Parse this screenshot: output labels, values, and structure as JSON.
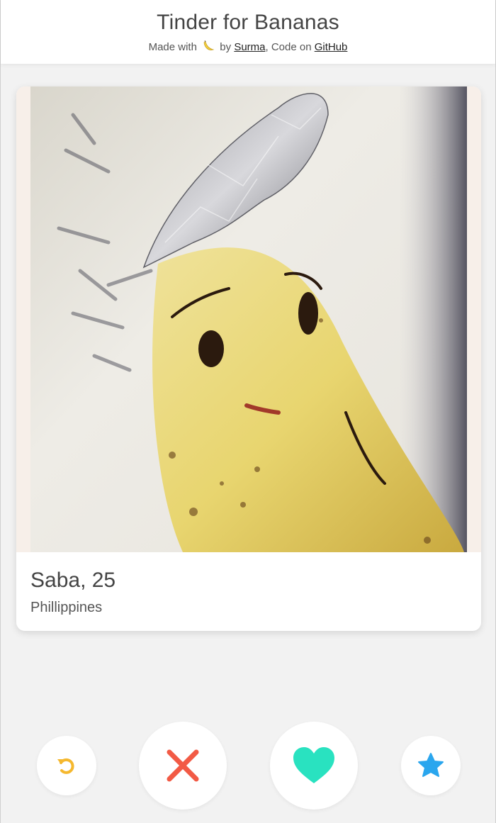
{
  "header": {
    "title": "Tinder for Bananas",
    "made_with": "Made with",
    "by": "by",
    "author": "Surma",
    "code_on": ", Code on",
    "repo": "GitHub"
  },
  "profile": {
    "name": "Saba",
    "age_separator": ", 25",
    "location": "Phillippines"
  },
  "actions": [
    {
      "id": "rewind",
      "icon": "rewind-icon",
      "color": "#f5b82e"
    },
    {
      "id": "nope",
      "icon": "close-icon",
      "color": "#f25a45"
    },
    {
      "id": "like",
      "icon": "heart-icon",
      "color": "#29e2c0"
    },
    {
      "id": "super-like",
      "icon": "star-icon",
      "color": "#2aa6ee"
    }
  ]
}
